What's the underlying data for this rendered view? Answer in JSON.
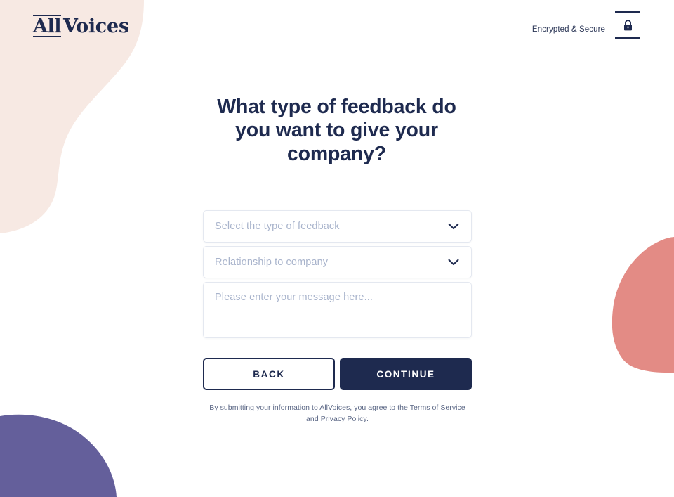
{
  "header": {
    "logo": {
      "part1": "All",
      "part2": "Voices"
    },
    "secure_label": "Encrypted & Secure",
    "lock_icon": "lock-icon"
  },
  "main": {
    "title": "What type of feedback do you want to give your company?",
    "fields": {
      "feedback_type": {
        "placeholder": "Select the type of feedback",
        "value": "",
        "chevron_icon": "chevron-down-icon"
      },
      "relationship": {
        "placeholder": "Relationship to company",
        "value": "",
        "chevron_icon": "chevron-down-icon"
      },
      "message": {
        "placeholder": "Please enter your message here...",
        "value": ""
      }
    },
    "buttons": {
      "back": "BACK",
      "continue": "CONTINUE"
    },
    "legal": {
      "text_before": "By submitting your information to AllVoices, you agree to the ",
      "terms_link": "Terms of Service",
      "text_middle": " and ",
      "privacy_link": "Privacy Policy",
      "text_after": "."
    }
  },
  "colors": {
    "navy": "#1e2a4f",
    "blob_pink": "#f7e9e3",
    "blob_salmon": "#e38b85",
    "blob_purple": "#645f9b",
    "placeholder": "#a9b4cc",
    "border": "#e4e8f0",
    "legal_text": "#5b6785",
    "background": "#ffffff"
  }
}
